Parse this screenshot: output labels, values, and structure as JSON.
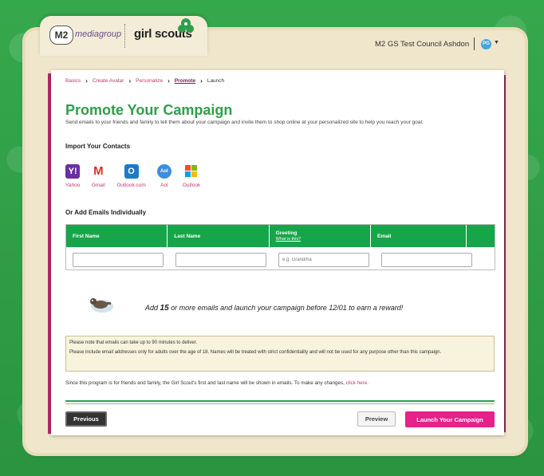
{
  "header": {
    "m2_badge": "M2",
    "m2_brand": "mediagroup",
    "gs_brand": "girl scouts",
    "user_name": "M2 GS Test Council Ashdon",
    "avatar_initials": "PG"
  },
  "breadcrumb": {
    "items": [
      "Basics",
      "Create Avatar",
      "Personalize",
      "Promote",
      "Launch"
    ],
    "active": "Promote"
  },
  "main": {
    "title": "Promote Your Campaign",
    "subtitle": "Send emails to your friends and family to tell them about your campaign and invite them to shop online at your personalized site to help you reach your goal.",
    "import_heading": "Import Your Contacts",
    "providers": [
      {
        "label": "Yahoo",
        "icon": "yahoo-icon",
        "color": "#6b2fa0",
        "glyph": "Y!"
      },
      {
        "label": "Gmail",
        "icon": "gmail-icon",
        "color": "#ffffff",
        "glyph": "M"
      },
      {
        "label": "Outlook.com",
        "icon": "outlook-com-icon",
        "color": "#1e7ac6",
        "glyph": "O"
      },
      {
        "label": "Aol",
        "icon": "aol-icon",
        "color": "#3d8ee0",
        "glyph": "Aol"
      },
      {
        "label": "Outlook",
        "icon": "windows-outlook-icon",
        "color": "#f0a020",
        "glyph": "W"
      }
    ],
    "individual_heading": "Or Add Emails Individually",
    "table": {
      "headers": [
        "First Name",
        "Last Name",
        "Greeting",
        "Email"
      ],
      "greeting_help": "What is this?",
      "greeting_placeholder": "e.g. Grandma"
    },
    "reward": {
      "prefix": "Add ",
      "count": "15",
      "suffix": " or more emails and launch your campaign before 12/01 to earn a reward!"
    },
    "notes": [
      "Please note that emails can take up to 90 minutes to deliver.",
      "Please include email addresses only for adults over the age of 18. Names will be treated with strict confidentiality and will not be used for any purpose other than this campaign."
    ],
    "since_text": "Since this program is for friends and family, the Girl Scout's first and last name will be shown in emails. To make any changes, ",
    "since_link": "click here."
  },
  "actions": {
    "previous": "Previous",
    "preview": "Preview",
    "launch": "Launch Your Campaign"
  },
  "colors": {
    "brand_green": "#2e9e4a",
    "accent_pink": "#e6218a",
    "link_pink": "#c0396f"
  }
}
